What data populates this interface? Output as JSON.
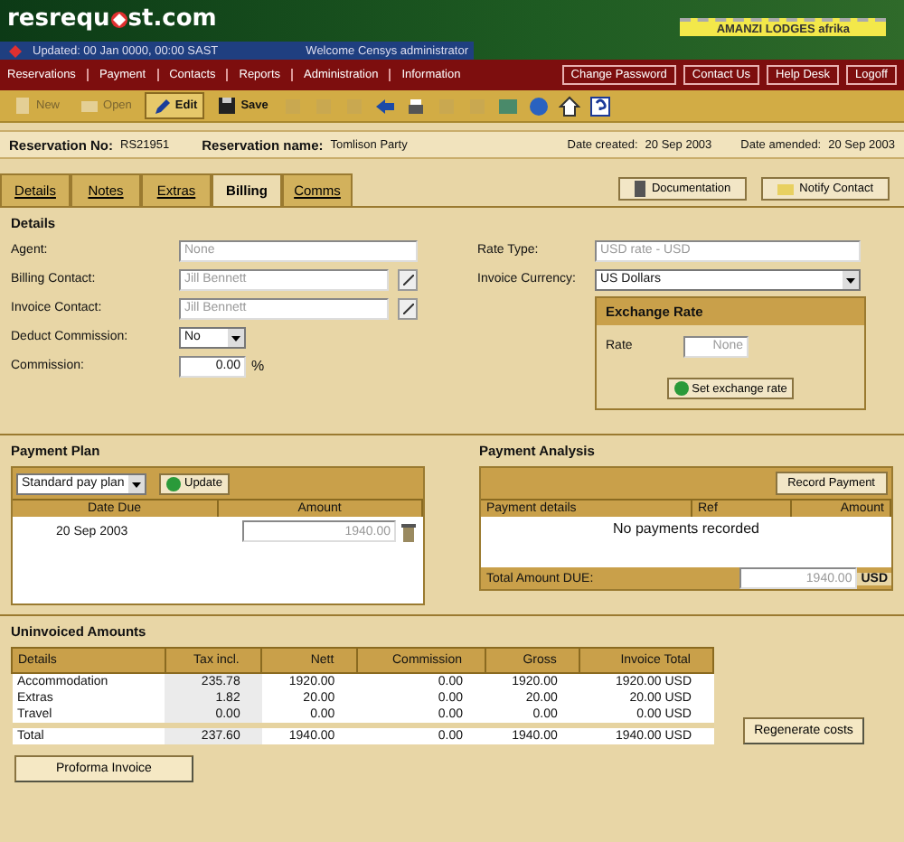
{
  "header": {
    "logo_parts": [
      "resrequ",
      "st.com"
    ],
    "updated": "Updated: 00 Jan 0000, 00:00 SAST",
    "welcome": "Welcome Censys administrator",
    "lodge": "AMANZI LODGES afrika"
  },
  "nav": {
    "items": [
      "Reservations",
      "Payment",
      "Contacts",
      "Reports",
      "Administration",
      "Information"
    ],
    "buttons": [
      "Change Password",
      "Contact Us",
      "Help Desk",
      "Logoff"
    ]
  },
  "toolbar": [
    {
      "label": "New",
      "disabled": true,
      "selected": false
    },
    {
      "label": "Open",
      "disabled": true,
      "selected": false
    },
    {
      "label": "Edit",
      "disabled": false,
      "selected": true
    },
    {
      "label": "Save",
      "disabled": false,
      "selected": false
    }
  ],
  "reservation": {
    "no_label": "Reservation No:",
    "no": "RS21951",
    "name_label": "Reservation name:",
    "name": "Tomlison Party",
    "created_label": "Date created:",
    "created": "20 Sep 2003",
    "amended_label": "Date amended:",
    "amended": "20 Sep 2003"
  },
  "tabs": [
    {
      "label": "Details",
      "selected": false
    },
    {
      "label": "Notes",
      "selected": false
    },
    {
      "label": "Extras",
      "selected": false
    },
    {
      "label": "Billing",
      "selected": true
    },
    {
      "label": "Comms",
      "selected": false
    }
  ],
  "actions": [
    "Documentation",
    "Notify Contact"
  ],
  "details": {
    "title": "Details",
    "agent_label": "Agent:",
    "agent": "None",
    "billing_label": "Billing Contact:",
    "billing": "Jill Bennett",
    "invoice_label": "Invoice Contact:",
    "invoice": "Jill Bennett",
    "deduct_label": "Deduct Commission:",
    "deduct": "No",
    "commission_label": "Commission:",
    "commission": "0.00",
    "percent": "%",
    "rate_type_label": "Rate Type:",
    "rate_type": "USD rate - USD",
    "currency_label": "Invoice Currency:",
    "currency": "US Dollars"
  },
  "exchange": {
    "title": "Exchange Rate",
    "rate_label": "Rate",
    "rate": "None",
    "button": "Set exchange rate"
  },
  "payment_plan": {
    "title": "Payment Plan",
    "plan": "Standard pay plan",
    "update": "Update",
    "columns": [
      "Date Due",
      "Amount"
    ],
    "rows": [
      {
        "date": "20 Sep 2003",
        "amount": "1940.00"
      }
    ]
  },
  "payment_analysis": {
    "title": "Payment Analysis",
    "record": "Record Payment",
    "columns": [
      "Payment details",
      "Ref",
      "Amount"
    ],
    "empty": "No payments recorded",
    "total_label": "Total Amount DUE:",
    "total": "1940.00",
    "currency": "USD"
  },
  "uninvoiced": {
    "title": "Uninvoiced Amounts",
    "columns": [
      "Details",
      "Tax incl.",
      "Nett",
      "Commission",
      "Gross",
      "Invoice Total"
    ],
    "rows": [
      [
        "Accommodation",
        "235.78",
        "1920.00",
        "0.00",
        "1920.00",
        "1920.00 USD"
      ],
      [
        "Extras",
        "1.82",
        "20.00",
        "0.00",
        "20.00",
        "20.00 USD"
      ],
      [
        "Travel",
        "0.00",
        "0.00",
        "0.00",
        "0.00",
        "0.00 USD"
      ]
    ],
    "total": [
      "Total",
      "237.60",
      "1940.00",
      "0.00",
      "1940.00",
      "1940.00 USD"
    ],
    "regenerate": "Regenerate costs",
    "proforma": "Proforma Invoice"
  }
}
